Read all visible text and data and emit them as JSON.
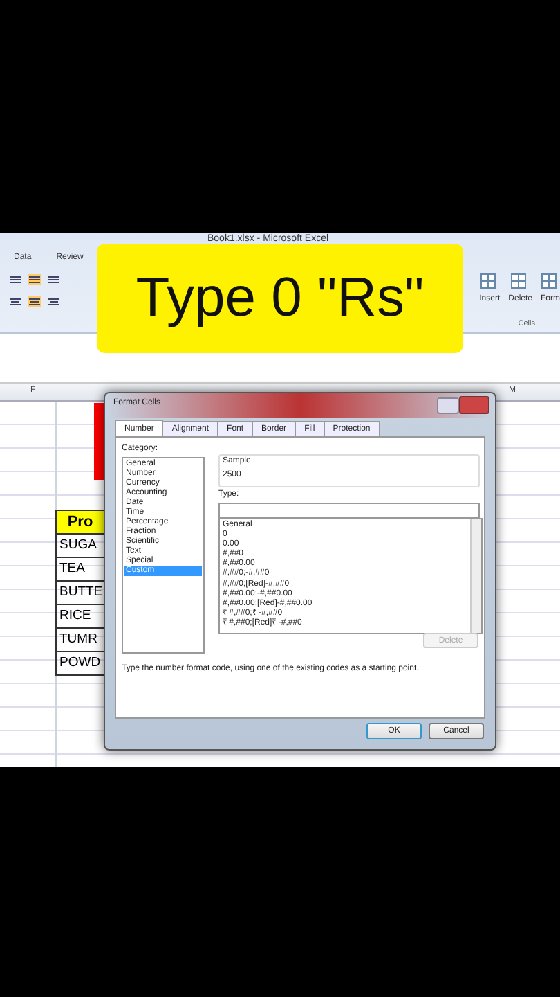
{
  "window": {
    "title": "Book1.xlsx - Microsoft Excel"
  },
  "ribbon": {
    "tabs": [
      "Data",
      "Review"
    ],
    "cell_buttons": [
      "Insert",
      "Delete",
      "Form"
    ],
    "group_label": "Cells"
  },
  "sheet": {
    "columns": [
      "F",
      "M"
    ],
    "table": {
      "header": "Pro",
      "rows": [
        "SUGA",
        "TEA",
        "BUTTE",
        "RICE",
        "TUMR",
        "POWD"
      ]
    }
  },
  "dialog": {
    "title": "Format Cells",
    "tabs": [
      {
        "label": "Number",
        "selected": true
      },
      {
        "label": "Alignment",
        "selected": false
      },
      {
        "label": "Font",
        "selected": false
      },
      {
        "label": "Border",
        "selected": false
      },
      {
        "label": "Fill",
        "selected": false
      },
      {
        "label": "Protection",
        "selected": false
      }
    ],
    "category_label": "Category:",
    "categories": [
      {
        "label": "General",
        "selected": false
      },
      {
        "label": "Number",
        "selected": false
      },
      {
        "label": "Currency",
        "selected": false
      },
      {
        "label": "Accounting",
        "selected": false
      },
      {
        "label": "Date",
        "selected": false
      },
      {
        "label": "Time",
        "selected": false
      },
      {
        "label": "Percentage",
        "selected": false
      },
      {
        "label": "Fraction",
        "selected": false
      },
      {
        "label": "Scientific",
        "selected": false
      },
      {
        "label": "Text",
        "selected": false
      },
      {
        "label": "Special",
        "selected": false
      },
      {
        "label": "Custom",
        "selected": true
      }
    ],
    "sample_label": "Sample",
    "sample_value": "2500",
    "type_label": "Type:",
    "formats": [
      "General",
      "0",
      "0.00",
      "#,##0",
      "#,##0.00",
      "#,##0;-#,##0",
      "#,##0;[Red]-#,##0",
      "#,##0.00;-#,##0.00",
      "#,##0.00;[Red]-#,##0.00",
      "₹ #,##0;₹ -#,##0",
      "₹ #,##0;[Red]₹ -#,##0"
    ],
    "delete_button": {
      "label": "Delete",
      "disabled": true
    },
    "description": "Type the number format code, using one of the existing codes as a starting point.",
    "buttons": [
      "OK",
      "Cancel"
    ]
  },
  "caption": "Type 0 \"Rs\""
}
